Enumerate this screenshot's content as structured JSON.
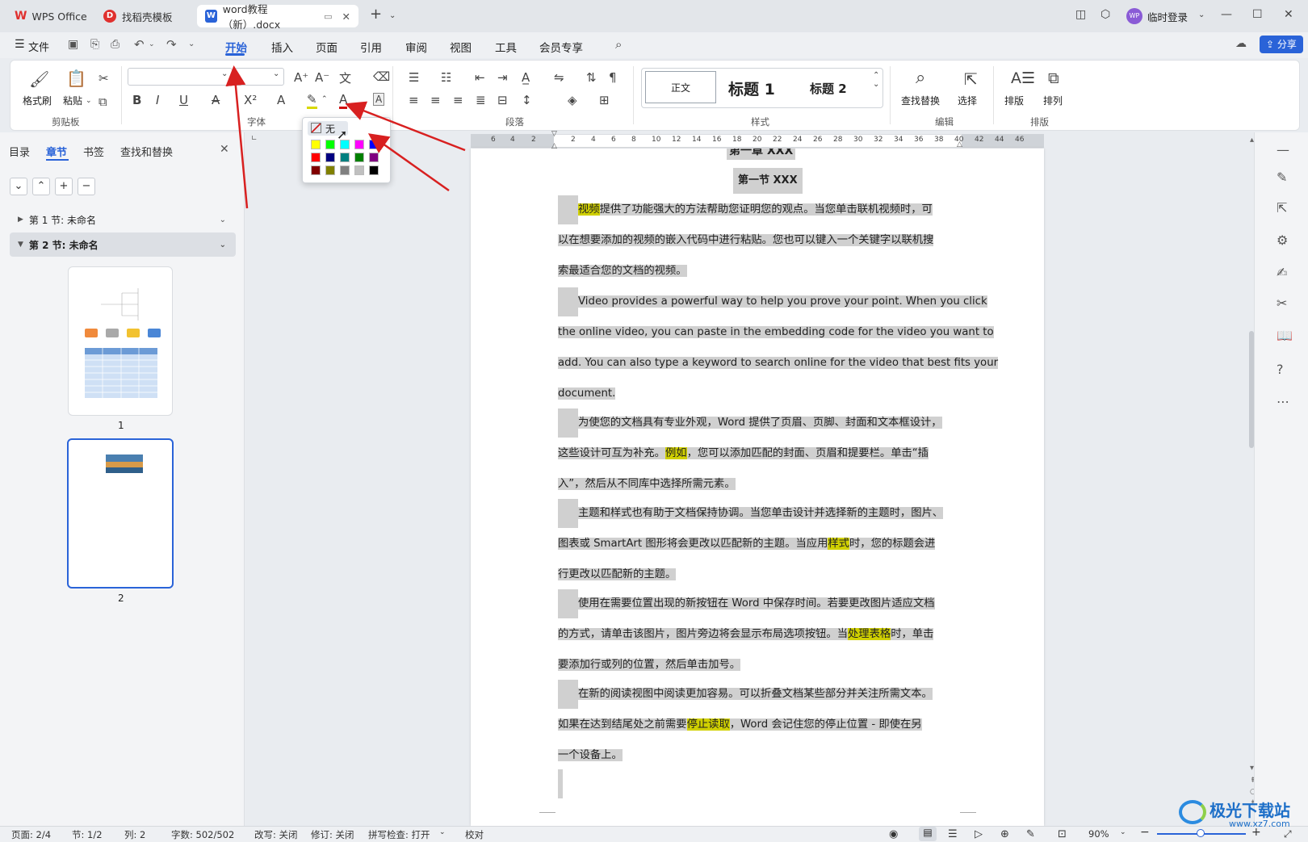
{
  "titlebar": {
    "tabs": [
      {
        "label": "WPS Office"
      },
      {
        "label": "找稻壳模板"
      },
      {
        "label": "word教程（新）.docx"
      }
    ],
    "user": "临时登录",
    "avatar": "WP"
  },
  "menu": {
    "file": "文件",
    "tabs": [
      "开始",
      "插入",
      "页面",
      "引用",
      "审阅",
      "视图",
      "工具",
      "会员专享"
    ],
    "share": "分享"
  },
  "ribbon": {
    "format_painter": "格式刷",
    "paste": "粘贴",
    "group_clipboard": "剪贴板",
    "group_font": "字体",
    "group_paragraph": "段落",
    "group_styles": "样式",
    "group_edit": "编辑",
    "group_layout": "排版",
    "find_replace": "查找替换",
    "select": "选择",
    "typeset": "排版",
    "arrange": "排列",
    "style_normal": "正文",
    "style_h1": "标题 1",
    "style_h2": "标题 2"
  },
  "highlight_dropdown": {
    "none_label": "无",
    "colors": [
      "#ffff00",
      "#00ff00",
      "#00ffff",
      "#ff00ff",
      "#0000ff",
      "#ff0000",
      "#000080",
      "#008080",
      "#008000",
      "#800080",
      "#800000",
      "#808000",
      "#808080",
      "#c0c0c0",
      "#000000"
    ]
  },
  "left_pane": {
    "tabs": [
      "目录",
      "章节",
      "书签",
      "查找和替换"
    ],
    "buttons": [
      "⌄",
      "⌃",
      "+",
      "−"
    ],
    "sections": [
      "第 1 节: 未命名",
      "第 2 节: 未命名"
    ],
    "thumbs": [
      "1",
      "2"
    ]
  },
  "ruler": {
    "ticks": [
      "6",
      "4",
      "2",
      "2",
      "4",
      "6",
      "8",
      "10",
      "12",
      "14",
      "16",
      "18",
      "20",
      "22",
      "24",
      "26",
      "28",
      "30",
      "32",
      "34",
      "36",
      "38",
      "40",
      "42",
      "44",
      "46"
    ]
  },
  "document": {
    "partial_heading": "第一章 XXX",
    "heading": "第一节 XXX",
    "lines": [
      [
        {
          "t": "视频",
          "h": "y"
        },
        {
          "t": "提供了功能强大的方法帮助您证明您的观点。当您单击联机视频时，可"
        }
      ],
      [
        {
          "t": "以在想要添加的视频的嵌入代码中进行粘贴。您也可以键入一个关键字以联机搜"
        }
      ],
      [
        {
          "t": "索最适合您的文档的视频。"
        }
      ],
      [
        {
          "t": "Video provides a powerful way to help you prove your point. When you click"
        }
      ],
      [
        {
          "t": "the online video, you can paste in the embedding code for the video you want to"
        }
      ],
      [
        {
          "t": "add. You can also type a keyword to search online for the video that best fits your"
        }
      ],
      [
        {
          "t": "document."
        }
      ],
      [
        {
          "t": "为使您的文档具有专业外观，Word 提供了页眉、页脚、封面和文本框设计，"
        }
      ],
      [
        {
          "t": "这些设计可互为补充。"
        },
        {
          "t": "例如",
          "h": "y"
        },
        {
          "t": "，您可以添加匹配的封面、页眉和提要栏。单击“插"
        }
      ],
      [
        {
          "t": "入”，然后从不同库中选择所需元素。"
        }
      ],
      [
        {
          "t": "主题和样式也有助于文档保持协调。当您单击设计并选择新的主题时，图片、"
        }
      ],
      [
        {
          "t": "图表或 SmartArt 图形将会更改以匹配新的主题。当应用"
        },
        {
          "t": "样式",
          "h": "y"
        },
        {
          "t": "时，您的标题会进"
        }
      ],
      [
        {
          "t": "行更改以匹配新的主题。"
        }
      ],
      [
        {
          "t": "使用在需要位置出现的新按钮在 Word 中保存时间。若要更改图片适应文档"
        }
      ],
      [
        {
          "t": "的方式，请单击该图片，图片旁边将会显示布局选项按钮。当"
        },
        {
          "t": "处理表格",
          "h": "y"
        },
        {
          "t": "时，单击"
        }
      ],
      [
        {
          "t": "要添加行或列的位置，然后单击加号。"
        }
      ],
      [
        {
          "t": "在新的阅读视图中阅读更加容易。可以折叠文档某些部分并关注所需文本。"
        }
      ],
      [
        {
          "t": "如果在达到结尾处之前需要"
        },
        {
          "t": "停止读取",
          "h": "y"
        },
        {
          "t": "，Word 会记住您的停止位置 - 即使在另"
        }
      ],
      [
        {
          "t": "一个设备上。"
        }
      ]
    ]
  },
  "status": {
    "page": "页面: 2/4",
    "section": "节: 1/2",
    "column": "列: 2",
    "words": "字数: 502/502",
    "revise": "改写: 关闭",
    "track": "修订: 关闭",
    "spell": "拼写检查: 打开",
    "proof": "校对",
    "zoom": "90%"
  },
  "watermark": {
    "text": "极光下载站",
    "url": "www.xz7.com"
  }
}
